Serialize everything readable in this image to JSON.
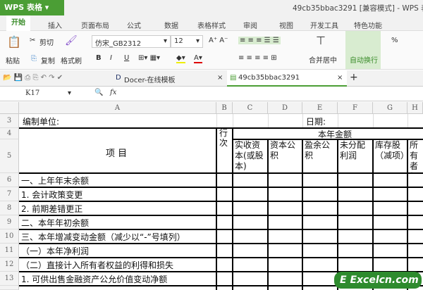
{
  "app": {
    "menu_button": "WPS 表格",
    "title": "49cb35bbac3291 [兼容模式] - WPS 表"
  },
  "ribbon_tabs": [
    "开始",
    "插入",
    "页面布局",
    "公式",
    "数据",
    "表格样式",
    "审阅",
    "视图",
    "开发工具",
    "特色功能"
  ],
  "toolbar": {
    "paste": "粘贴",
    "cut": "剪切",
    "copy": "复制",
    "format_painter": "格式刷",
    "font": "仿宋_GB2312",
    "size": "12",
    "bold": "B",
    "italic": "I",
    "underline": "U",
    "merge": "合并居中",
    "wrap": "自动换行",
    "percent": "%"
  },
  "doc_tabs": [
    {
      "label": "Docer-在线模板"
    },
    {
      "label": "49cb35bbac3291"
    }
  ],
  "formula_bar": {
    "cell_ref": "K17",
    "fx": "fx"
  },
  "columns": [
    "A",
    "B",
    "C",
    "D",
    "E",
    "F",
    "G",
    "H"
  ],
  "rows": {
    "r3": "3",
    "r4": "4",
    "r5": "5",
    "r6": "6",
    "r7": "7",
    "r8": "8",
    "r9": "9",
    "r10": "10",
    "r11": "11",
    "r12": "12",
    "r13": "13"
  },
  "sheet": {
    "unit_label": "编制单位:",
    "date_label": "日期:",
    "item_header": "项 目",
    "line_header": "行次",
    "year_amount": "本年金额",
    "sub_headers": [
      "实收资本(或股本)",
      "资本公积",
      "盈余公积",
      "未分配利润",
      "库存股（减项）",
      "所有者权益合计"
    ],
    "items": [
      "一、上年年末余额",
      "1. 会计政策变更",
      "2. 前期差错更正",
      "二、本年年初余额",
      "三、本年增减变动金额（减少以“-”号填列）",
      "（一）本年净利润",
      "（二）直接计入所有者权益的利得和损失",
      "1. 可供出售金融资产公允价值变动净额"
    ]
  },
  "watermark": "Excelcn.com"
}
